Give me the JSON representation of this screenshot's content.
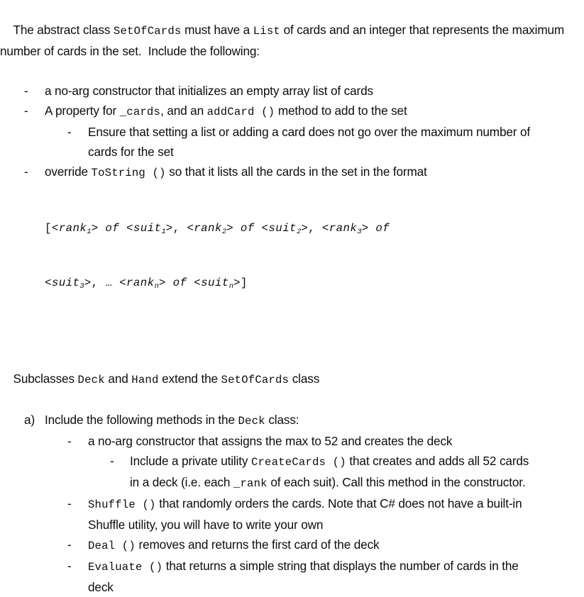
{
  "document": {
    "intro": {
      "seg1": "The abstract class ",
      "code1": "SetOfCards",
      "seg2": " must have a ",
      "code2": "List",
      "seg3": " of cards and an integer that represents the maximum number of cards in the set.  Include the following:"
    },
    "bullets": {
      "noarg_ctor": "a no-arg constructor that initializes an empty array list of cards",
      "property": {
        "seg1": "A property for ",
        "code1": "_cards",
        "seg2": ", and an ",
        "code2": "addCard ()",
        "seg3": " method to add to the set"
      },
      "ensure_max": "Ensure that setting a list or adding a card does not go over the maximum number of cards for the set",
      "override_tostring": {
        "seg1": "override ",
        "code1": "ToString ()",
        "seg2": " so that it lists all the cards in the set in the format"
      }
    },
    "format_spec": {
      "line1_open": "[<",
      "line1": "[<rank₁> of <suit₁>, <rank₂> of <suit₂>, <rank₃> of",
      "line2": "<suit₃>, … <rankₙ> of <suitₙ>]",
      "tokens": {
        "rank": "rank",
        "suit": "suit",
        "of": "of",
        "sub1": "1",
        "sub2": "2",
        "sub3": "3",
        "subn": "n",
        "ellipsis": "…",
        "lt": "<",
        "gt": ">",
        "comma": ",",
        "open_bracket": "[",
        "close_bracket": "]"
      }
    },
    "subclasses": {
      "seg1": "Subclasses ",
      "code1": "Deck",
      "seg2": " and ",
      "code2": "Hand",
      "seg3": " extend the ",
      "code3": "SetOfCards",
      "seg4": " class"
    },
    "item_a": {
      "marker": "a)",
      "seg1": "Include the following methods in the ",
      "code1": "Deck",
      "seg2": " class:"
    },
    "deck_methods": {
      "ctor": "a no-arg constructor that assigns the max to 52 and creates the deck",
      "create_cards": {
        "seg1": "Include a private utility ",
        "code1": "CreateCards ()",
        "seg2": " that creates and adds all 52 cards in a deck (i.e. each ",
        "code2": "_rank",
        "seg3": " of each suit).  Call this method in the constructor."
      },
      "shuffle": {
        "code1": "Shuffle ()",
        "seg1": " that randomly orders the cards.  Note that C# does not have a built-in Shuffle utility, you will have to write your own"
      },
      "deal": {
        "code1": "Deal ()",
        "seg1": "  removes and returns the first card of the deck"
      },
      "evaluate": {
        "code1": "Evaluate ()",
        "seg1": " that returns a simple string that displays the number of cards in the deck"
      }
    },
    "markers": {
      "dash": "-",
      "alpha_a": "a)"
    },
    "colors": {
      "text": "#0d0d0d",
      "background": "#ffffff"
    }
  }
}
